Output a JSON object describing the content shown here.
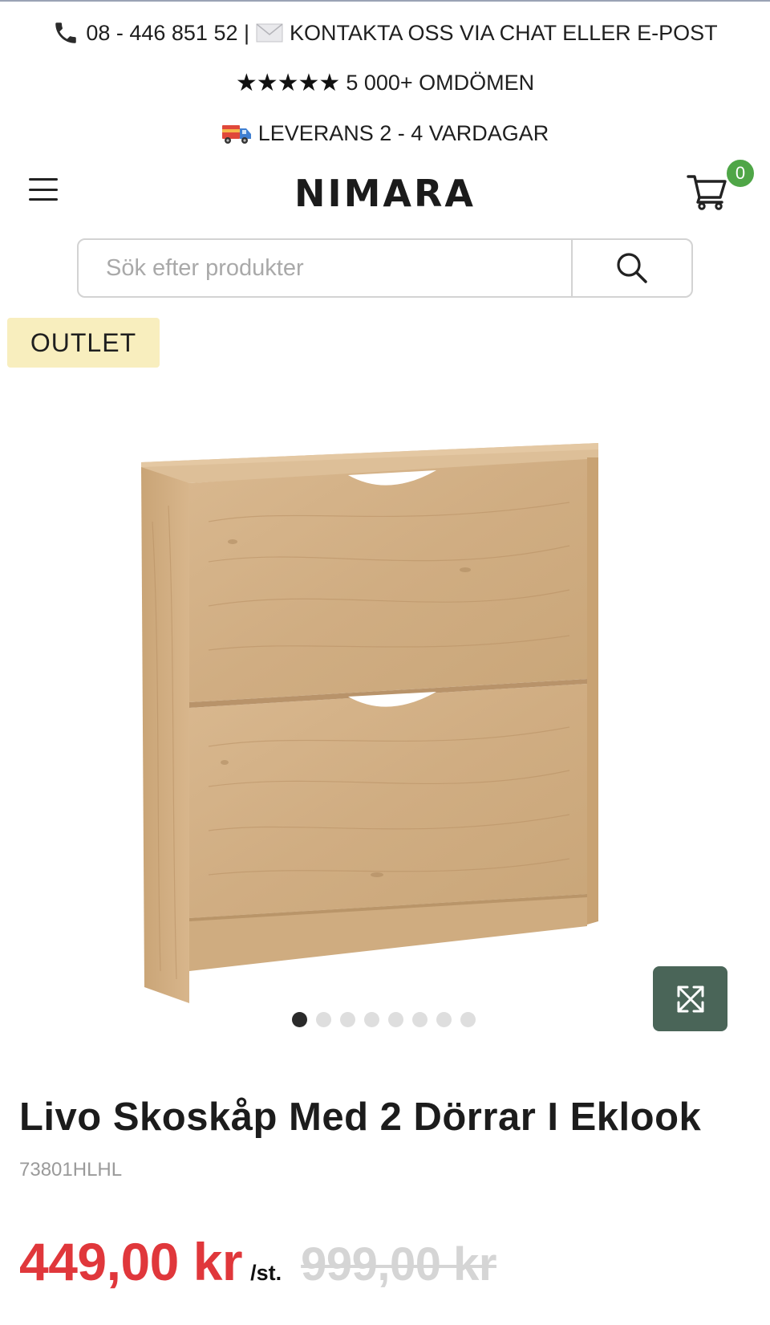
{
  "announcements": {
    "phone_icon": "phone-icon",
    "contact_text": "08 - 446 851 52 |",
    "mail_icon": "envelope-icon",
    "contact_cta": "KONTAKTA OSS VIA CHAT ELLER E-POST",
    "stars": "★★★★★",
    "reviews_text": "5 000+ OMDÖMEN",
    "truck_icon": "delivery-truck-icon",
    "delivery_text": "LEVERANS 2 - 4 VARDAGAR"
  },
  "header": {
    "logo": "NIMARA",
    "cart_count": "0"
  },
  "search": {
    "placeholder": "Sök efter produkter"
  },
  "badge": {
    "label": "OUTLET"
  },
  "gallery": {
    "slide_count": 8,
    "active_index": 0
  },
  "product": {
    "title": "Livo Skoskåp Med 2 Dörrar I Eklook",
    "sku": "73801HLHL",
    "price": "449,00 kr",
    "unit": "/st.",
    "old_price": "999,00 kr"
  },
  "colors": {
    "accent_green": "#4fa647",
    "expand_button": "#4a6558",
    "price_red": "#e0373b",
    "outlet_bg": "#f8eebe"
  }
}
